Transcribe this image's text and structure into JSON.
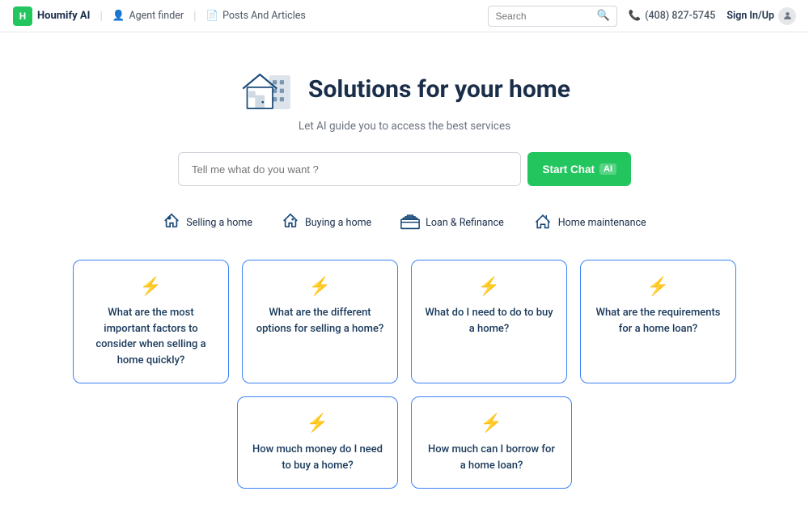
{
  "navbar": {
    "logo_label": "Houmify AI",
    "nav_links": [
      {
        "id": "agent-finder",
        "icon": "👤",
        "label": "Agent finder"
      },
      {
        "id": "posts-articles",
        "icon": "📄",
        "label": "Posts And Articles"
      }
    ],
    "search_placeholder": "Search",
    "phone": "(408) 827-5745",
    "signin_label": "Sign In/Up"
  },
  "hero": {
    "title": "Solutions for your home",
    "subtitle": "Let AI guide you to access the best services",
    "chat_placeholder": "Tell me what do you want ?",
    "start_chat_label": "Start Chat",
    "ai_badge": "AI"
  },
  "categories": [
    {
      "id": "selling",
      "label": "Selling a home"
    },
    {
      "id": "buying",
      "label": "Buying a home"
    },
    {
      "id": "loan",
      "label": "Loan & Refinance"
    },
    {
      "id": "maintenance",
      "label": "Home maintenance"
    }
  ],
  "cards_row1": [
    {
      "id": "card1",
      "text": "What are the most important factors to consider when selling a home quickly?"
    },
    {
      "id": "card2",
      "text": "What are the different options for selling a home?"
    },
    {
      "id": "card3",
      "text": "What do I need to do to buy a home?"
    },
    {
      "id": "card4",
      "text": "What are the requirements for a home loan?"
    }
  ],
  "cards_row2": [
    {
      "id": "card5",
      "text": "How much money do I need to buy a home?"
    },
    {
      "id": "card6",
      "text": "How much can I borrow for a home loan?"
    }
  ]
}
